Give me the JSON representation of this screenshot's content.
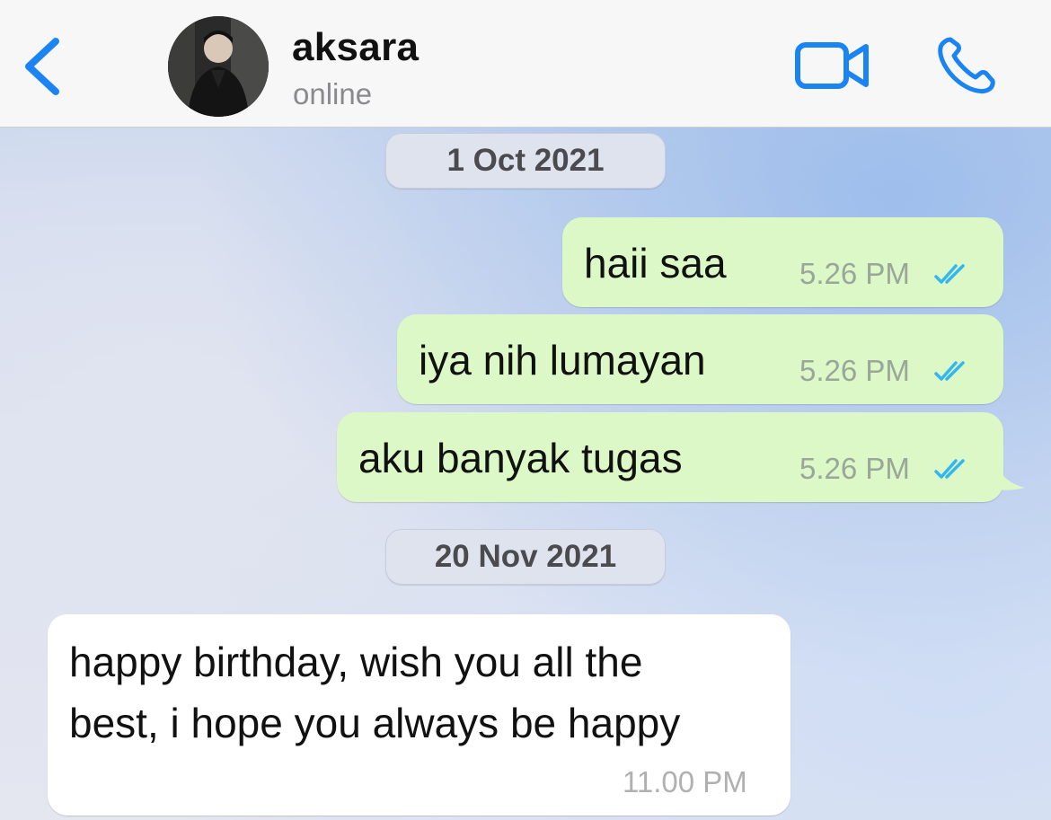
{
  "header": {
    "contact_name": "aksara",
    "status": "online",
    "accent_color": "#1a84f4"
  },
  "messages": [
    {
      "date": "1 Oct 2021"
    },
    {
      "direction": "outgoing",
      "text": "haii saa",
      "time": "5.26 PM",
      "read": true
    },
    {
      "direction": "outgoing",
      "text": "iya nih lumayan",
      "time": "5.26 PM",
      "read": true
    },
    {
      "direction": "outgoing",
      "text": "aku banyak tugas",
      "time": "5.26 PM",
      "read": true
    },
    {
      "date": "20 Nov 2021"
    },
    {
      "direction": "incoming",
      "text_lines": [
        "happy birthday, wish you all the",
        "best, i hope you always be happy"
      ],
      "time": "11.00 PM"
    }
  ],
  "colors": {
    "outgoing_bubble": "#dcf8c6",
    "incoming_bubble": "#ffffff",
    "read_ticks": "#34b7f1"
  }
}
